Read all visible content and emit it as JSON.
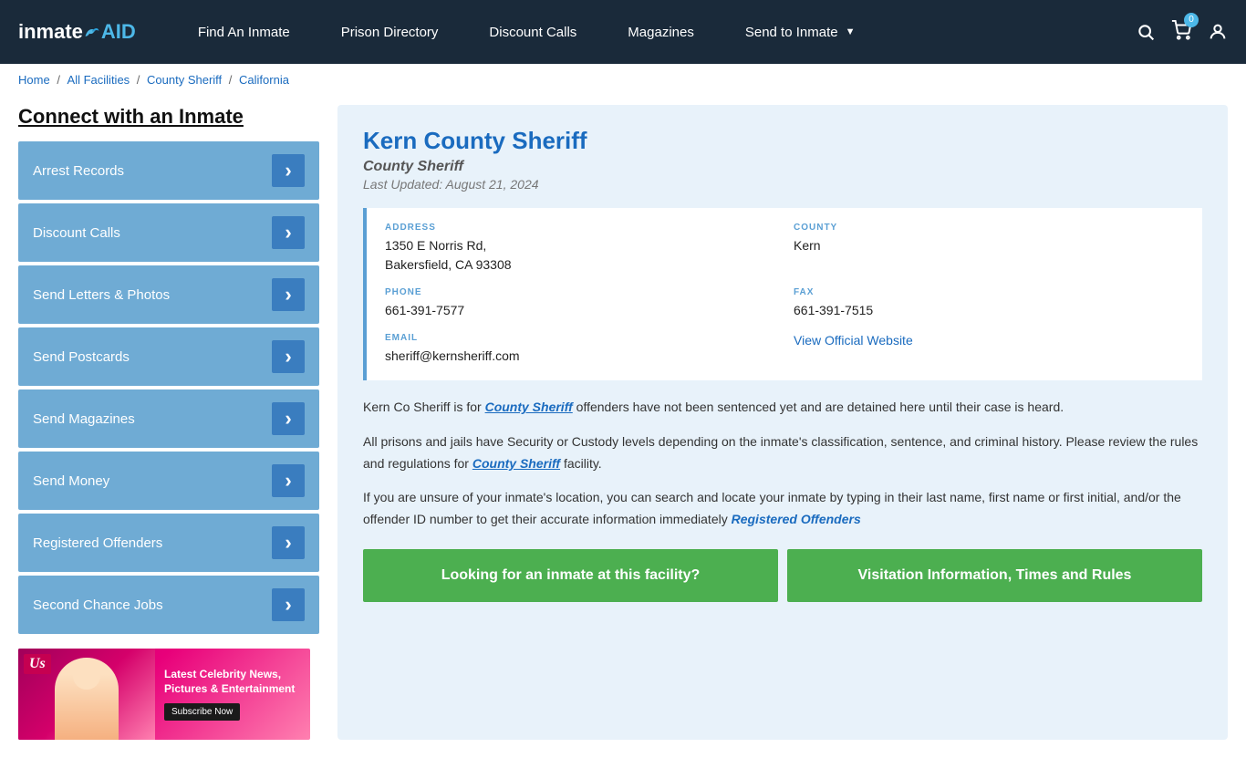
{
  "header": {
    "logo": "inmateAID",
    "nav": [
      {
        "id": "find-inmate",
        "label": "Find An Inmate",
        "hasDropdown": false
      },
      {
        "id": "prison-directory",
        "label": "Prison Directory",
        "hasDropdown": false
      },
      {
        "id": "discount-calls",
        "label": "Discount Calls",
        "hasDropdown": false
      },
      {
        "id": "magazines",
        "label": "Magazines",
        "hasDropdown": false
      },
      {
        "id": "send-to-inmate",
        "label": "Send to Inmate",
        "hasDropdown": true
      }
    ],
    "cart_count": "0",
    "search_tooltip": "Search",
    "cart_tooltip": "Cart",
    "user_tooltip": "Account"
  },
  "breadcrumb": {
    "items": [
      "Home",
      "All Facilities",
      "County Sheriff",
      "California"
    ]
  },
  "sidebar": {
    "title": "Connect with an Inmate",
    "menu_items": [
      {
        "id": "arrest-records",
        "label": "Arrest Records"
      },
      {
        "id": "discount-calls",
        "label": "Discount Calls"
      },
      {
        "id": "send-letters-photos",
        "label": "Send Letters & Photos"
      },
      {
        "id": "send-postcards",
        "label": "Send Postcards"
      },
      {
        "id": "send-magazines",
        "label": "Send Magazines"
      },
      {
        "id": "send-money",
        "label": "Send Money"
      },
      {
        "id": "registered-offenders",
        "label": "Registered Offenders"
      },
      {
        "id": "second-chance-jobs",
        "label": "Second Chance Jobs"
      }
    ]
  },
  "ad": {
    "title": "Latest Celebrity News, Pictures & Entertainment",
    "button_label": "Subscribe Now"
  },
  "facility": {
    "name": "Kern County Sheriff",
    "type": "County Sheriff",
    "last_updated": "Last Updated: August 21, 2024",
    "address_label": "ADDRESS",
    "address": "1350 E Norris Rd,\nBakersfield, CA 93308",
    "county_label": "COUNTY",
    "county": "Kern",
    "phone_label": "PHONE",
    "phone": "661-391-7577",
    "fax_label": "FAX",
    "fax": "661-391-7515",
    "email_label": "EMAIL",
    "email": "sheriff@kernsheriff.com",
    "website_label": "View Official Website",
    "website_url": "#",
    "description1": "Kern Co Sheriff is for ",
    "description1_link": "County Sheriff",
    "description1_rest": " offenders have not been sentenced yet and are detained here until their case is heard.",
    "description2": "All prisons and jails have Security or Custody levels depending on the inmate's classification, sentence, and criminal history. Please review the rules and regulations for ",
    "description2_link": "County Sheriff",
    "description2_rest": " facility.",
    "description3": "If you are unsure of your inmate's location, you can search and locate your inmate by typing in their last name, first name or first initial, and/or the offender ID number to get their accurate information immediately ",
    "description3_link": "Registered Offenders",
    "btn1_label": "Looking for an inmate at this facility?",
    "btn2_label": "Visitation Information, Times and Rules"
  }
}
